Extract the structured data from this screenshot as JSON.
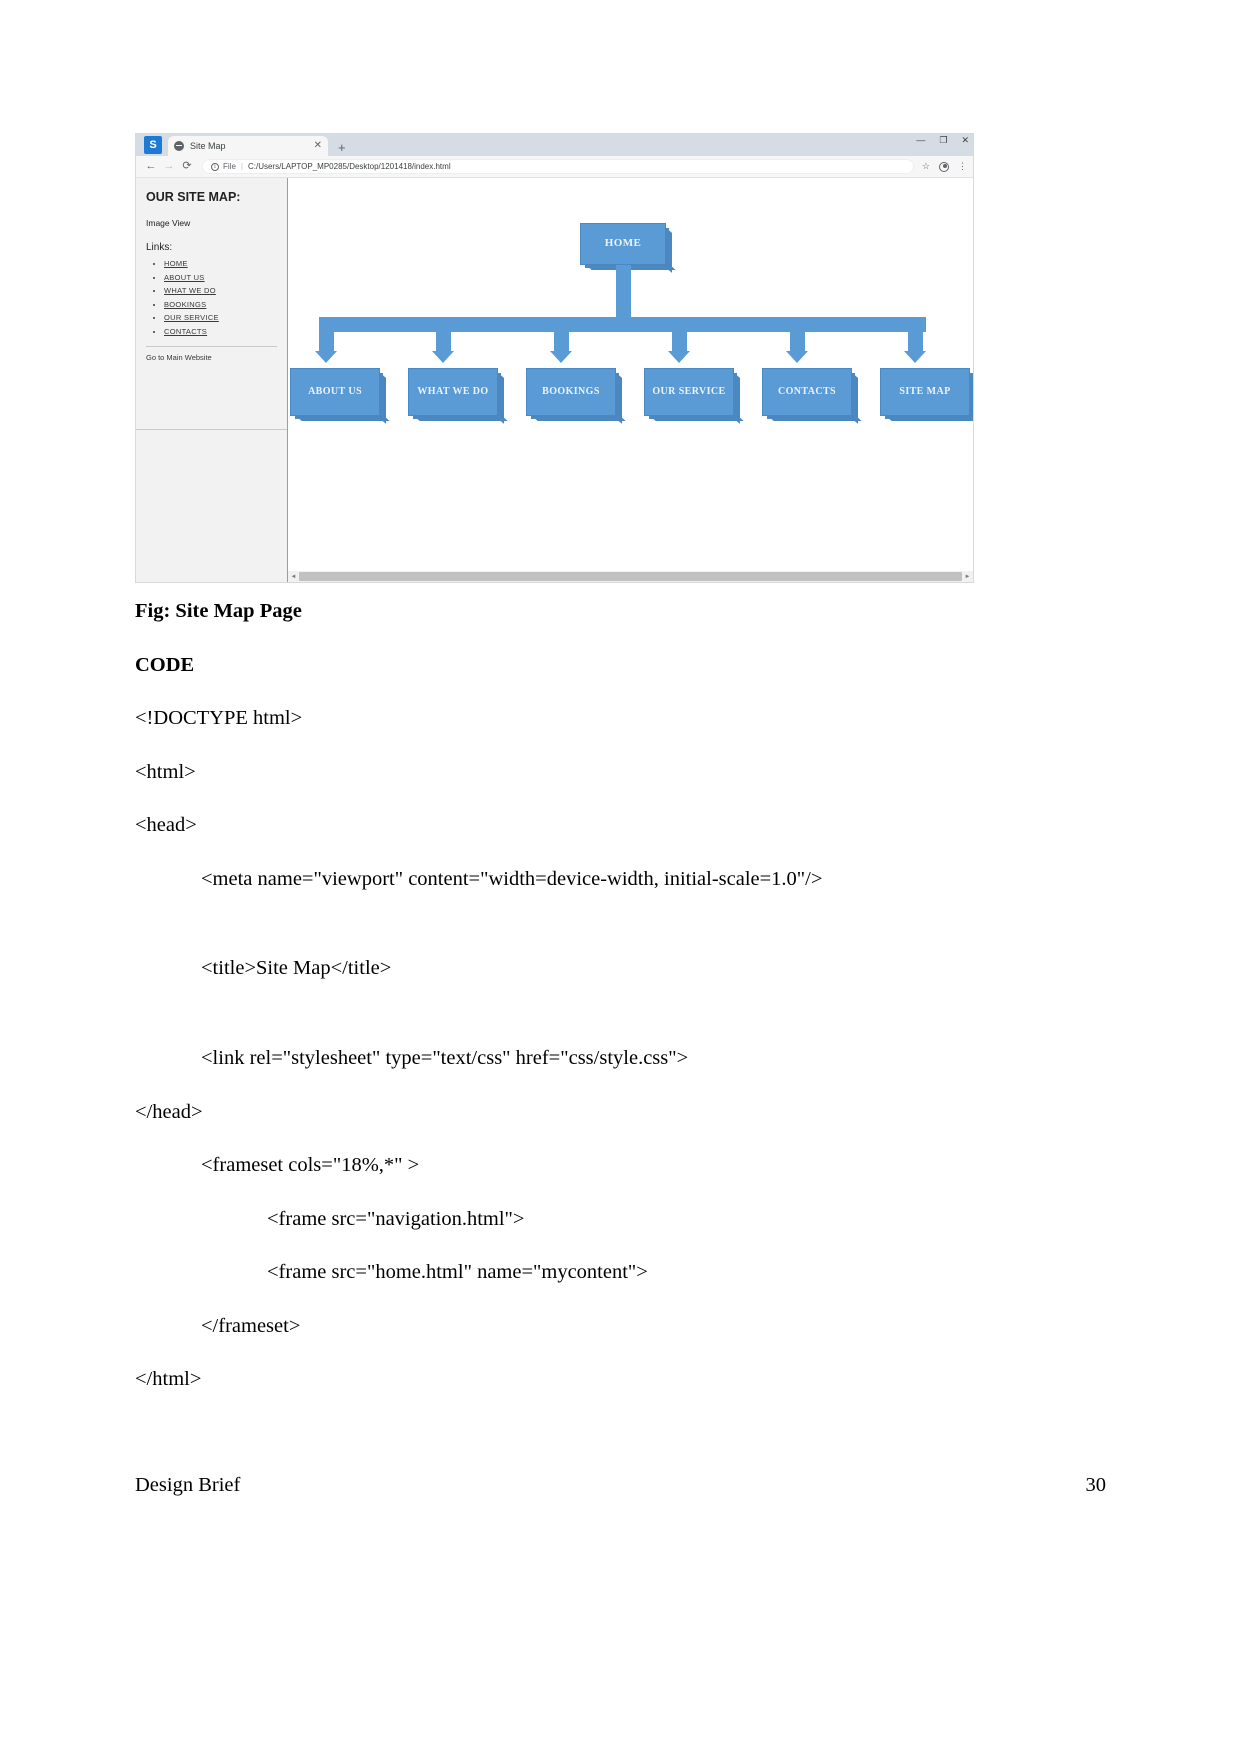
{
  "browser": {
    "app_badge": "S",
    "tab": {
      "title": "Site Map",
      "close": "✕",
      "favicon": "globe-icon"
    },
    "new_tab": "+",
    "window_controls": {
      "minimize": "—",
      "maximize": "❐",
      "close": "✕"
    },
    "toolbar": {
      "back": "←",
      "forward": "→",
      "reload": "⟳",
      "info_icon": "i",
      "file_label": "File",
      "separator": "|",
      "url": "C:/Users/LAPTOP_MP0285/Desktop/1201418/index.html",
      "star": "☆",
      "profile": "avatar-icon",
      "menu": "⋮"
    }
  },
  "page": {
    "sidebar": {
      "title": "OUR SITE MAP:",
      "subtitle": "Image View",
      "links_label": "Links:",
      "links": [
        "HOME",
        "ABOUT US",
        "WHAT WE DO",
        "BOOKINGS",
        "OUR SERVICE",
        "CONTACTS"
      ],
      "go_to_main": "Go to Main Website"
    },
    "sitemap": {
      "root": "HOME",
      "children": [
        "ABOUT US",
        "WHAT WE DO",
        "BOOKINGS",
        "OUR SERVICE",
        "CONTACTS",
        "SITE MAP"
      ],
      "node_color": "#5b9bd5",
      "node_text_color": "#eaf3fb"
    },
    "scrollbar": {
      "left_arrow": "◄",
      "right_arrow": "►"
    }
  },
  "document": {
    "figure_caption": "Fig: Site Map Page",
    "code_heading": "CODE",
    "code_lines": [
      {
        "text": "<!DOCTYPE html>",
        "indent": 0
      },
      {
        "text": "<html>",
        "indent": 0
      },
      {
        "text": "<head>",
        "indent": 0
      },
      {
        "text": "<meta name=\"viewport\" content=\"width=device-width, initial-scale=1.0\"/>",
        "indent": 1
      },
      {
        "text": "",
        "indent": 0
      },
      {
        "text": "<title>Site Map</title>",
        "indent": 1
      },
      {
        "text": "",
        "indent": 0
      },
      {
        "text": "<link rel=\"stylesheet\" type=\"text/css\" href=\"css/style.css\">",
        "indent": 1
      },
      {
        "text": "</head>",
        "indent": 0
      },
      {
        "text": "<frameset cols=\"18%,*\" >",
        "indent": 1
      },
      {
        "text": "<frame src=\"navigation.html\">",
        "indent": 2
      },
      {
        "text": "<frame src=\"home.html\" name=\"mycontent\">",
        "indent": 2
      },
      {
        "text": "</frameset>",
        "indent": 1
      },
      {
        "text": "</html>",
        "indent": 0
      }
    ],
    "footer_left": "Design Brief",
    "footer_right": "30"
  }
}
